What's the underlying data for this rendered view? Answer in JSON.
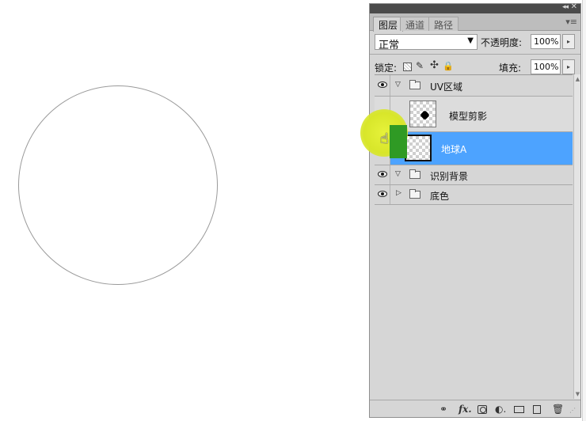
{
  "panel": {
    "collapse_glyph": "◂◂",
    "close_glyph": "✕",
    "tabs": [
      {
        "label": "图层",
        "active": true
      },
      {
        "label": "通道",
        "active": false
      },
      {
        "label": "路径",
        "active": false
      }
    ],
    "menu_glyph": "▾≡"
  },
  "blend": {
    "mode": "正常",
    "arrow": "▼",
    "opacity_label": "不透明度:",
    "opacity_value": "100%",
    "opacity_btn": "▸"
  },
  "lock": {
    "label": "锁定:",
    "brush_glyph": "✎",
    "move_glyph": "✣",
    "all_glyph": "🔒",
    "fill_label": "填充:",
    "fill_value": "100%",
    "fill_btn": "▸"
  },
  "layers": [
    {
      "name": "UV区域",
      "type": "group",
      "expanded": true,
      "visible": true
    },
    {
      "name": "模型剪影",
      "type": "layer",
      "visible": false
    },
    {
      "name": "地球A",
      "type": "layer",
      "visible": true,
      "selected": true
    },
    {
      "name": "识别背景",
      "type": "group",
      "expanded": true,
      "visible": true
    },
    {
      "name": "底色",
      "type": "group",
      "expanded": false,
      "visible": true
    }
  ],
  "glyphs": {
    "expanded": "▽",
    "collapsed": "▷",
    "scroll_up": "▲",
    "scroll_down": "▼",
    "hand": "☝"
  },
  "bottom_bar": {
    "link": "⚭",
    "fx": "fx.",
    "adjust": "◐.",
    "trash": "🗑",
    "grip": "⋰"
  },
  "colors": {
    "selected_row": "#4da3ff",
    "panel_bg": "#d6d6d6",
    "titlebar": "#4b4b4b",
    "cursor_highlight": "#e6f23a"
  }
}
